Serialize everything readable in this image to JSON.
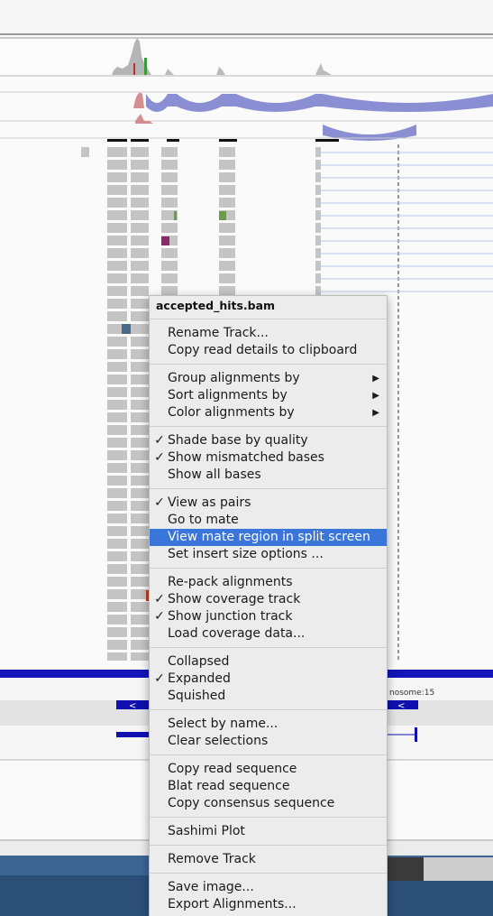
{
  "track_menu": {
    "title": "accepted_hits.bam",
    "groups": [
      [
        {
          "label": "Rename Track...",
          "checked": false,
          "submenu": false
        },
        {
          "label": "Copy read details to clipboard",
          "checked": false,
          "submenu": false
        }
      ],
      [
        {
          "label": "Group alignments by",
          "checked": false,
          "submenu": true
        },
        {
          "label": "Sort alignments by",
          "checked": false,
          "submenu": true
        },
        {
          "label": "Color alignments by",
          "checked": false,
          "submenu": true
        }
      ],
      [
        {
          "label": "Shade base by quality",
          "checked": true,
          "submenu": false
        },
        {
          "label": "Show mismatched bases",
          "checked": true,
          "submenu": false
        },
        {
          "label": "Show all bases",
          "checked": false,
          "submenu": false
        }
      ],
      [
        {
          "label": "View as pairs",
          "checked": true,
          "submenu": false
        },
        {
          "label": "Go to mate",
          "checked": false,
          "submenu": false
        },
        {
          "label": "View mate region in split screen",
          "checked": false,
          "submenu": false,
          "highlighted": true
        },
        {
          "label": "Set insert size options ...",
          "checked": false,
          "submenu": false
        }
      ],
      [
        {
          "label": "Re-pack alignments",
          "checked": false,
          "submenu": false
        },
        {
          "label": "Show coverage track",
          "checked": true,
          "submenu": false
        },
        {
          "label": "Show junction track",
          "checked": true,
          "submenu": false
        },
        {
          "label": "Load coverage data...",
          "checked": false,
          "submenu": false
        }
      ],
      [
        {
          "label": "Collapsed",
          "checked": false,
          "submenu": false
        },
        {
          "label": "Expanded",
          "checked": true,
          "submenu": false
        },
        {
          "label": "Squished",
          "checked": false,
          "submenu": false
        }
      ],
      [
        {
          "label": "Select by name...",
          "checked": false,
          "submenu": false
        },
        {
          "label": "Clear selections",
          "checked": false,
          "submenu": false
        }
      ],
      [
        {
          "label": "Copy read sequence",
          "checked": false,
          "submenu": false
        },
        {
          "label": "Blat read sequence",
          "checked": false,
          "submenu": false
        },
        {
          "label": "Copy consensus sequence",
          "checked": false,
          "submenu": false
        }
      ],
      [
        {
          "label": "Sashimi Plot",
          "checked": false,
          "submenu": false
        }
      ],
      [
        {
          "label": "Remove Track",
          "checked": false,
          "submenu": false
        }
      ],
      [
        {
          "label": "Save image...",
          "checked": false,
          "submenu": false
        },
        {
          "label": "Export Alignments...",
          "checked": false,
          "submenu": false
        }
      ]
    ],
    "check_glyph": "✓",
    "submenu_glyph": "▶"
  },
  "gene_track": {
    "chromosome_label": "nosome:15"
  },
  "colors": {
    "highlight": "#3a75d9",
    "junction": "#8a8fd4",
    "gene": "#1010b0",
    "read": "#c4c4c4",
    "mismatch_green": "#6a9a4a",
    "mismatch_purple": "#8a2a6a",
    "mismatch_blue": "#4a6a8a",
    "mismatch_red": "#c04020"
  }
}
